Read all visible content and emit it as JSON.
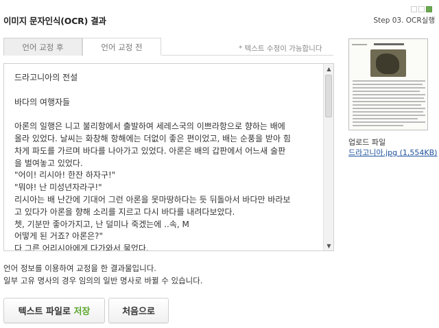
{
  "header": {
    "title": "이미지 문자인식(OCR) 결과",
    "step_label": "Step 03. OCR실행",
    "steps_total": 3,
    "steps_done": 1
  },
  "tabs": [
    {
      "label": "언어 교정 후",
      "active": true
    },
    {
      "label": "언어 교정 전",
      "active": false
    }
  ],
  "edit_note": "* 텍스트 수정이 가능합니다",
  "ocr_text": {
    "heading": "드라고니아의 전설",
    "subheading": "바다의 여행자들",
    "lines": [
      "아론의 일행은 니고 불리항에서 출발하여 세레스국의 이쁘라항으로 향하는 배에",
      "올라 있었다. 날씨는 화창해 항해에는 더없이 좋은 편이었고, 배는 순풍을 받아 힘",
      "차게 파도를 가르며 바다를 나아가고 있었다. 아론은 배의 갑판에서 어느새 술판",
      "을 벌여놓고 있었다.",
      "\"어이! 리시아! 한잔 하자구!\"",
      "\"뭐야! 난 미성년자라구!\"",
      "리시아는 배 난간에 기대어 그런 아론을 못마땅하다는 듯 뒤돌아서 바다만 바라보",
      "고 있다가 아론을 향해 소리를 지르고 다시 바다를 내려다보았다.",
      "쳇, 기분만 좋아가지고, 난 덜미나 죽겠는에 ..속, M",
      "어떻게 된 거죠? 아론은?\"",
      "다 그른 어리시아에게 다가와서 물었다."
    ]
  },
  "description": [
    "언어 정보를 이용하여 교정을 한 결과물입니다.",
    "일부 고유 명사의 경우 임의의 일반 명사로 바뀔 수 있습니다."
  ],
  "buttons": {
    "save_prefix": "텍스트 파일로",
    "save_highlight": "저장",
    "home": "처음으로"
  },
  "upload": {
    "label": "업로드 파일",
    "file_link": "드라고니아.jpg (1,554KB)"
  },
  "colors": {
    "accent_green": "#5aa62a",
    "step_on": "#6aa84f",
    "link": "#1a4f9c"
  }
}
